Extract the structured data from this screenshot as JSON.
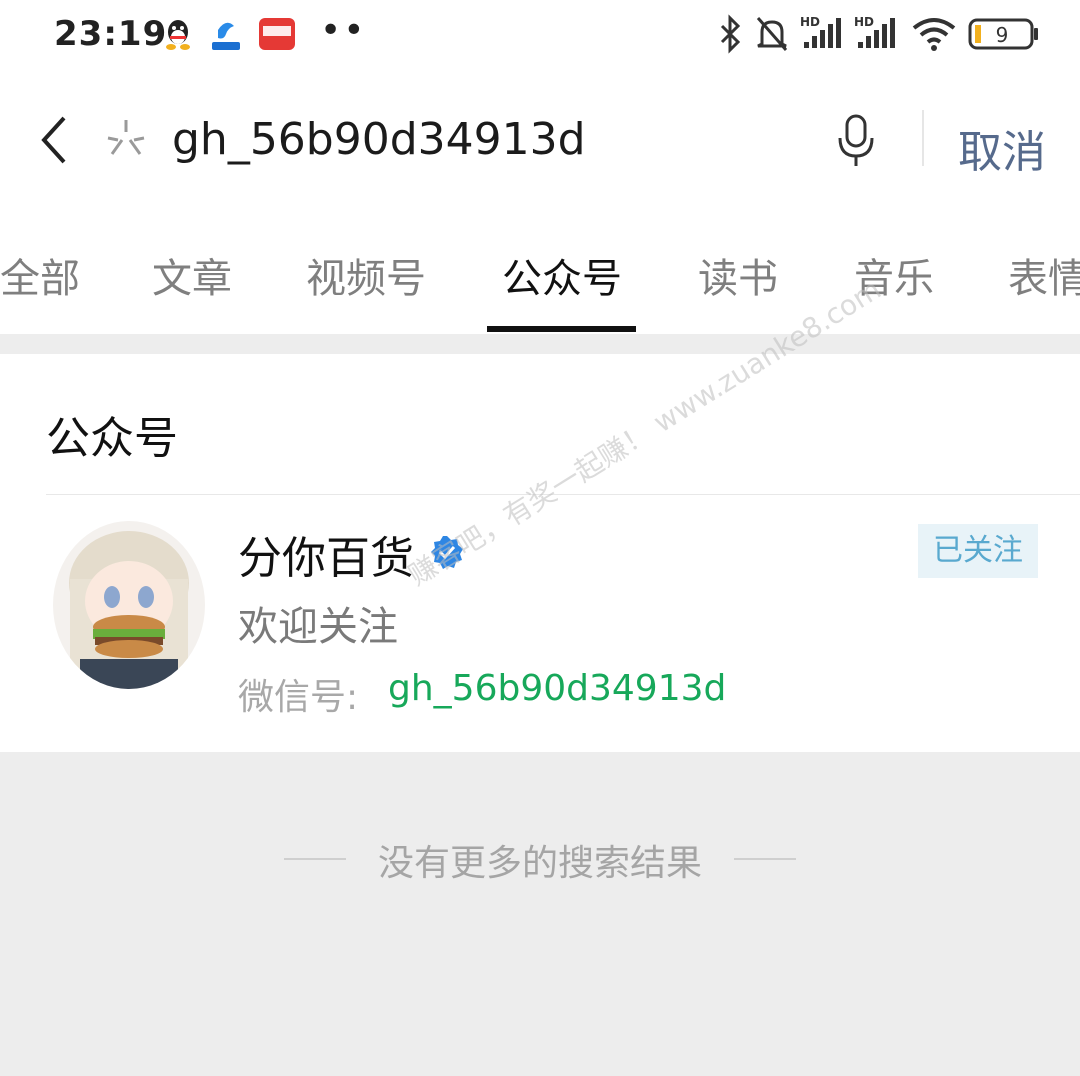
{
  "status_bar": {
    "time": "23:19",
    "battery": "9",
    "signal_label_1": "HD",
    "signal_label_2": "HD"
  },
  "search": {
    "query": "gh_56b90d34913d",
    "cancel_label": "取消"
  },
  "tabs": [
    {
      "label": "全部"
    },
    {
      "label": "文章"
    },
    {
      "label": "视频号"
    },
    {
      "label": "公众号",
      "active": true
    },
    {
      "label": "读书"
    },
    {
      "label": "音乐"
    },
    {
      "label": "表情"
    }
  ],
  "results": {
    "section_title": "公众号",
    "account": {
      "name": "分你百货",
      "follow_status": "已关注",
      "description": "欢迎关注",
      "wechat_id_label": "微信号:",
      "wechat_id": "gh_56b90d34913d"
    },
    "end_message": "没有更多的搜索结果"
  },
  "watermark": "赚客吧，有奖一起赚！ www.zuanke8.com",
  "colors": {
    "green": "#17a85a",
    "blue_text": "#566a8c",
    "badge_bg": "#e8f3f8"
  }
}
